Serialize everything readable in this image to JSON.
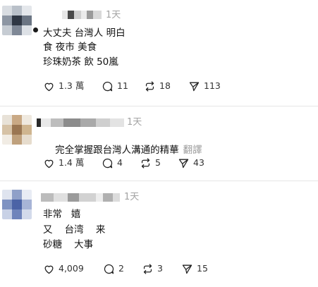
{
  "posts": [
    {
      "time": "1天",
      "lines": [
        "大丈夫 台灣人 明白",
        "食 夜市 美食",
        "珍珠奶茶 飲 50嵐"
      ],
      "translate": "",
      "stats": {
        "likes": "1.3 萬",
        "comments": "11",
        "reposts": "18",
        "shares": "113"
      }
    },
    {
      "time": "1天",
      "lines": [
        "完全掌握跟台灣人溝通的精華"
      ],
      "translate": "翻譯",
      "stats": {
        "likes": "1.4 萬",
        "comments": "4",
        "reposts": "5",
        "shares": "43"
      }
    },
    {
      "time": "1天",
      "lines": [
        "非常   嬉",
        "又    台湾    来",
        "砂糖    大事"
      ],
      "translate": "",
      "stats": {
        "likes": "4,009",
        "comments": "2",
        "reposts": "3",
        "shares": "15"
      }
    }
  ],
  "icons": {
    "like": "heart-icon",
    "comment": "comment-bubble-icon",
    "repost": "repost-icon",
    "share": "send-icon"
  },
  "colors": {
    "text": "#101010",
    "muted": "#a3a3a3",
    "divider": "#e6e6e6"
  }
}
